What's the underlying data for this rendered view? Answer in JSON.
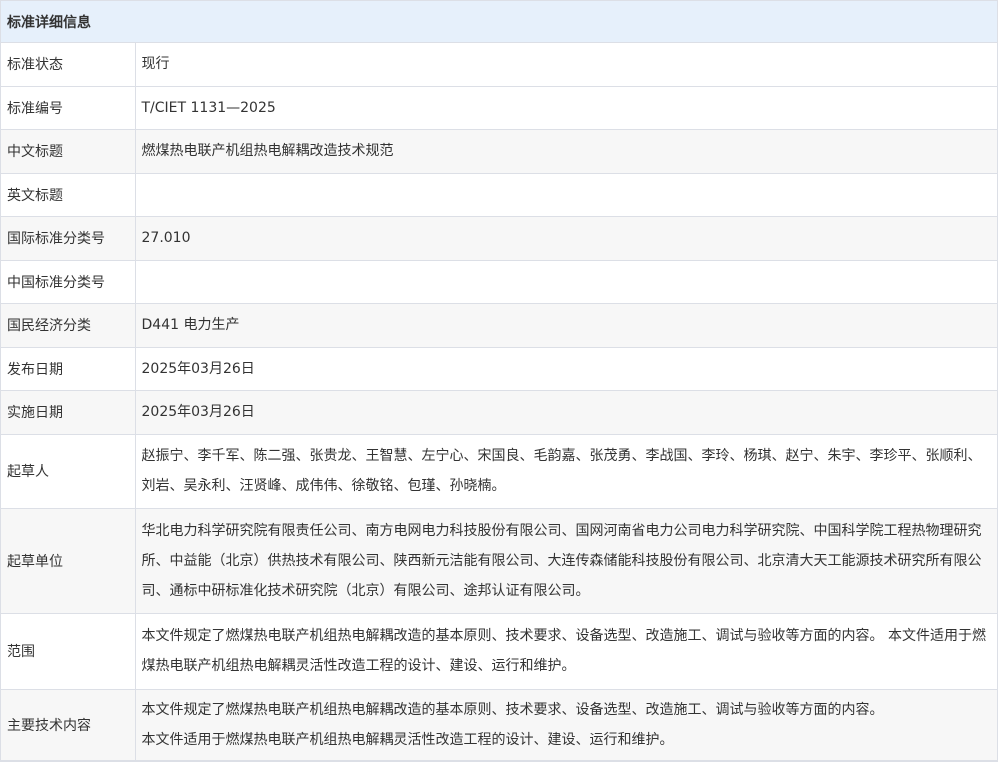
{
  "panel": {
    "title": "标准详细信息"
  },
  "rows": [
    {
      "label": "标准状态",
      "value": "现行"
    },
    {
      "label": "标准编号",
      "value": "T/CIET 1131—2025"
    },
    {
      "label": "中文标题",
      "value": "燃煤热电联产机组热电解耦改造技术规范"
    },
    {
      "label": "英文标题",
      "value": ""
    },
    {
      "label": "国际标准分类号",
      "value": "27.010"
    },
    {
      "label": "中国标准分类号",
      "value": ""
    },
    {
      "label": "国民经济分类",
      "value": "D441 电力生产"
    },
    {
      "label": "发布日期",
      "value": "2025年03月26日"
    },
    {
      "label": "实施日期",
      "value": "2025年03月26日"
    },
    {
      "label": "起草人",
      "value": "赵振宁、李千军、陈二强、张贵龙、王智慧、左宁心、宋国良、毛韵嘉、张茂勇、李战国、李玲、杨琪、赵宁、朱宇、李珍平、张顺利、刘岩、吴永利、汪贤峰、成伟伟、徐敬铭、包瑾、孙晓楠。"
    },
    {
      "label": "起草单位",
      "value": "华北电力科学研究院有限责任公司、南方电网电力科技股份有限公司、国网河南省电力公司电力科学研究院、中国科学院工程热物理研究所、中益能（北京）供热技术有限公司、陕西新元洁能有限公司、大连传森储能科技股份有限公司、北京清大天工能源技术研究所有限公司、通标中研标准化技术研究院（北京）有限公司、途邦认证有限公司。"
    },
    {
      "label": "范围",
      "value": "本文件规定了燃煤热电联产机组热电解耦改造的基本原则、技术要求、设备选型、改造施工、调试与验收等方面的内容。 本文件适用于燃煤热电联产机组热电解耦灵活性改造工程的设计、建设、运行和维护。"
    },
    {
      "label": "主要技术内容",
      "value_lines": [
        "本文件规定了燃煤热电联产机组热电解耦改造的基本原则、技术要求、设备选型、改造施工、调试与验收等方面的内容。",
        "本文件适用于燃煤热电联产机组热电解耦灵活性改造工程的设计、建设、运行和维护。"
      ]
    }
  ]
}
